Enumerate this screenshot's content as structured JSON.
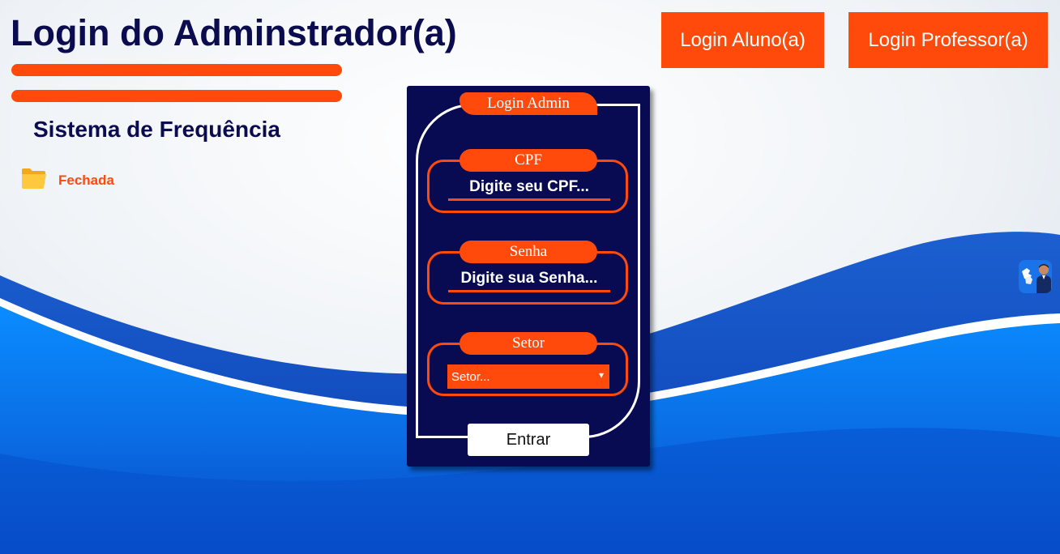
{
  "header": {
    "title": "Login do Adminstrador(a)",
    "subtitle": "Sistema de Frequência"
  },
  "status": {
    "icon": "folder-icon",
    "label": "Fechada",
    "color": "#ff4a0c"
  },
  "nav": {
    "aluno_label": "Login Aluno(a)",
    "professor_label": "Login Professor(a)"
  },
  "login_form": {
    "legend": "Login Admin",
    "cpf": {
      "label": "CPF",
      "placeholder": "Digite seu CPF...",
      "value": ""
    },
    "senha": {
      "label": "Senha",
      "placeholder": "Digite sua Senha...",
      "value": ""
    },
    "setor": {
      "label": "Setor",
      "selected": "Setor..."
    },
    "submit_label": "Entrar"
  },
  "accessibility": {
    "icon": "sign-language-icon"
  },
  "colors": {
    "accent": "#ff4a0c",
    "navy": "#0b0b4f",
    "panel": "#080a52",
    "wave_blue": "#0a74e8"
  }
}
